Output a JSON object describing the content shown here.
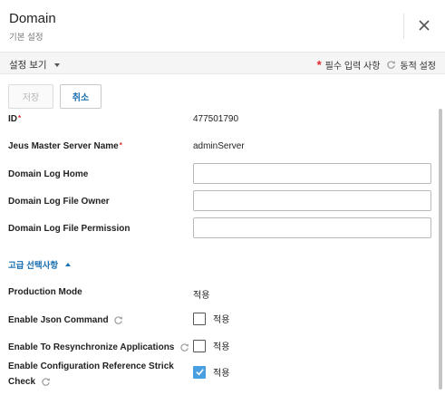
{
  "header": {
    "title": "Domain",
    "subtitle": "기본 설정"
  },
  "toolbar": {
    "view_label": "설정 보기",
    "required_label": "필수 입력 사항",
    "dynamic_label": "동적 설정"
  },
  "actions": {
    "save_label": "저장",
    "cancel_label": "취소"
  },
  "form": {
    "id": {
      "label": "ID",
      "value": "477501790"
    },
    "master_server": {
      "label": "Jeus Master Server Name",
      "value": "adminServer"
    },
    "log_home": {
      "label": "Domain Log Home",
      "value": ""
    },
    "log_owner": {
      "label": "Domain Log File Owner",
      "value": ""
    },
    "log_permission": {
      "label": "Domain Log File Permission",
      "value": ""
    }
  },
  "advanced": {
    "toggle_label": "고급 선택사항",
    "production_mode": {
      "label": "Production Mode",
      "value": "적용"
    },
    "json_command": {
      "label": "Enable Json Command",
      "option": "적용",
      "checked": false
    },
    "resync": {
      "label": "Enable To Resynchronize Applications",
      "option": "적용",
      "checked": false
    },
    "config_ref_line1": "Enable Configuration Reference Strick",
    "config_ref_line2": "Check",
    "config_ref": {
      "option": "적용",
      "checked": true
    }
  },
  "colors": {
    "accent": "#1a6fb0",
    "required": "#e0252b",
    "checkbox_checked": "#4a9fe0"
  }
}
